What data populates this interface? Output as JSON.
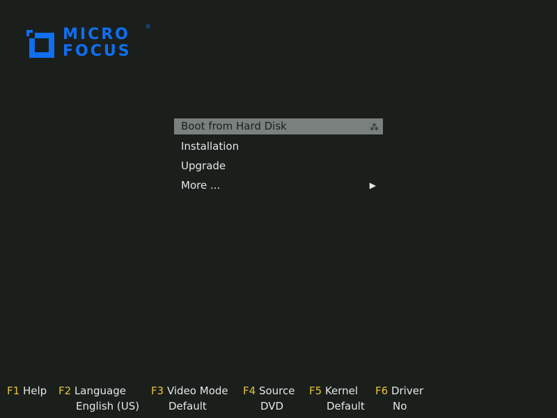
{
  "logo": {
    "line1": "MICRO",
    "line2": "FOCUS",
    "registered": "®"
  },
  "menu": {
    "items": [
      {
        "label": "Boot from Hard Disk",
        "selected": true
      },
      {
        "label": "Installation"
      },
      {
        "label": "Upgrade"
      },
      {
        "label": "More ..."
      }
    ],
    "spinner_glyph": "⁂",
    "submenu_arrow": "▶"
  },
  "fkeys": [
    {
      "key": "F1",
      "label": "Help",
      "value": ""
    },
    {
      "key": "F2",
      "label": "Language",
      "value": "English (US)"
    },
    {
      "key": "F3",
      "label": "Video Mode",
      "value": "Default"
    },
    {
      "key": "F4",
      "label": "Source",
      "value": "DVD"
    },
    {
      "key": "F5",
      "label": "Kernel",
      "value": "Default"
    },
    {
      "key": "F6",
      "label": "Driver",
      "value": "No"
    }
  ],
  "colors": {
    "background": "#1a1f1c",
    "brand_blue": "#0f6ff0",
    "selection": "#7a807d",
    "fkey_yellow": "#e8c23a",
    "text": "#e6e6e6"
  }
}
